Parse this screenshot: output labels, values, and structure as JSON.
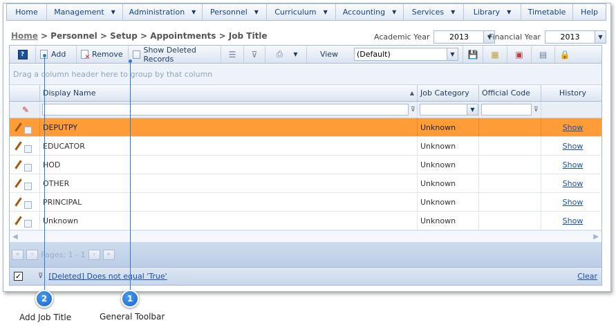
{
  "menu": {
    "items": [
      {
        "label": "Home",
        "dropdown": false
      },
      {
        "label": "Management",
        "dropdown": true
      },
      {
        "label": "Administration",
        "dropdown": true
      },
      {
        "label": "Personnel",
        "dropdown": true
      },
      {
        "label": "Curriculum",
        "dropdown": true
      },
      {
        "label": "Accounting",
        "dropdown": true
      },
      {
        "label": "Services",
        "dropdown": true
      },
      {
        "label": "Library",
        "dropdown": true
      },
      {
        "label": "Timetable",
        "dropdown": false
      },
      {
        "label": "Help",
        "dropdown": false
      }
    ]
  },
  "breadcrumb": {
    "home": "Home",
    "path": "> Personnel > Setup > Appointments > Job Title"
  },
  "years": {
    "academic_label": "Academic Year",
    "academic_value": "2013",
    "financial_label": "Financial Year",
    "financial_value": "2013"
  },
  "toolbar": {
    "add_label": "Add",
    "remove_label": "Remove",
    "show_deleted_label": "Show Deleted Records",
    "view_label": "View",
    "view_value": "(Default)"
  },
  "grid": {
    "group_hint": "Drag a column header here to group by that column",
    "columns": {
      "display_name": "Display Name",
      "job_category": "Job Category",
      "official_code": "Official Code",
      "history": "History"
    },
    "rows": [
      {
        "name": "DEPUTPY",
        "category": "Unknown",
        "code": "",
        "history": "Show",
        "selected": true
      },
      {
        "name": "EDUCATOR",
        "category": "Unknown",
        "code": "",
        "history": "Show",
        "selected": false
      },
      {
        "name": "HOD",
        "category": "Unknown",
        "code": "",
        "history": "Show",
        "selected": false
      },
      {
        "name": "OTHER",
        "category": "Unknown",
        "code": "",
        "history": "Show",
        "selected": false
      },
      {
        "name": "PRINCIPAL",
        "category": "Unknown",
        "code": "",
        "history": "Show",
        "selected": false
      },
      {
        "name": "Unknown",
        "category": "Unknown",
        "code": "",
        "history": "Show",
        "selected": false
      }
    ]
  },
  "pager": {
    "text": "Pages: 1 - 1"
  },
  "status": {
    "filter_text": "[Deleted] Does not equal 'True'",
    "clear_label": "Clear"
  },
  "callouts": [
    {
      "number": "2",
      "label": "Add Job Title"
    },
    {
      "number": "1",
      "label": "General Toolbar"
    }
  ],
  "colors": {
    "selected_row": "#fe9c38",
    "callout": "#1565c8",
    "link": "#1a4fa6"
  }
}
